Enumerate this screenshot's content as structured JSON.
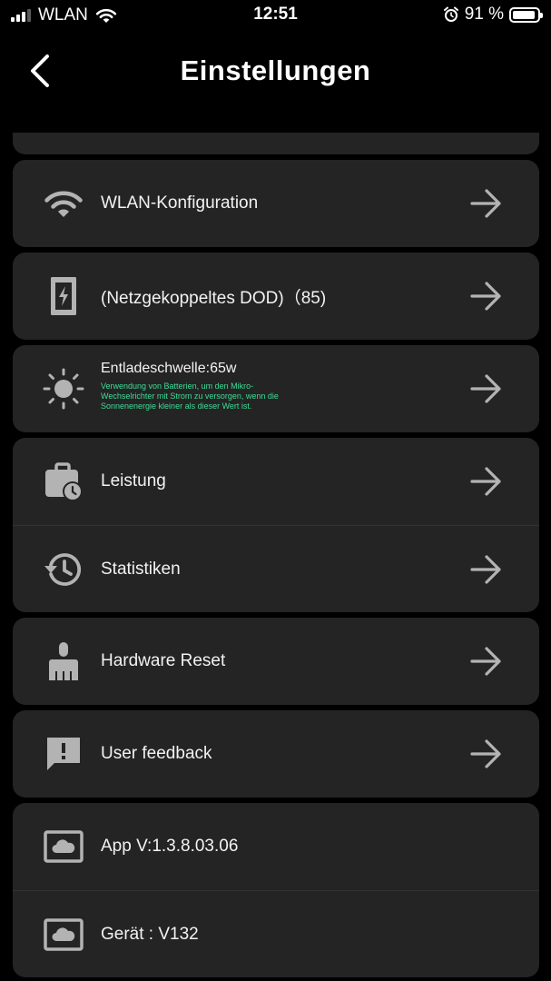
{
  "status_bar": {
    "carrier": "WLAN",
    "time": "12:51",
    "battery_percent": "91 %",
    "battery_level": 0.91
  },
  "header": {
    "title": "Einstellungen"
  },
  "items": {
    "wlan": {
      "label": "WLAN-Konfiguration",
      "icon": "wifi-icon"
    },
    "dod": {
      "label": "(Netzgekoppeltes DOD)（85)",
      "icon": "battery-charging-icon"
    },
    "discharge": {
      "label": "Entladeschwelle:65w",
      "description": "Verwendung von Batterien, um den Mikro-Wechselrichter mit Strom zu versorgen, wenn die Sonnenenergie kleiner als dieser Wert ist.",
      "icon": "sun-icon"
    },
    "leistung": {
      "label": "Leistung",
      "icon": "briefcase-clock-icon"
    },
    "statistiken": {
      "label": "Statistiken",
      "icon": "history-icon"
    },
    "reset": {
      "label": "Hardware Reset",
      "icon": "broom-icon"
    },
    "feedback": {
      "label": "User feedback",
      "icon": "feedback-icon"
    },
    "app_version": {
      "label": "App V:1.3.8.03.06",
      "icon": "cloud-box-icon"
    },
    "device_version": {
      "label": "Gerät : V132",
      "icon": "cloud-box-icon"
    }
  },
  "colors": {
    "background": "#000000",
    "card": "#242424",
    "icon": "#b3b3b3",
    "accent_text": "#3ddc97"
  }
}
